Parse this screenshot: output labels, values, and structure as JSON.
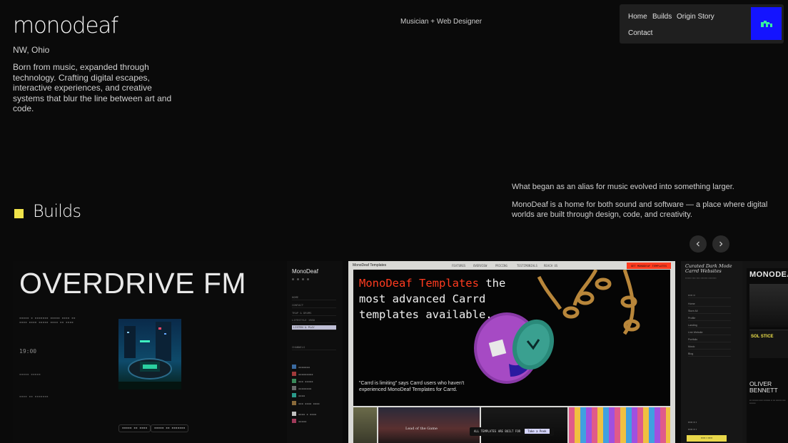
{
  "header": {
    "logo": "monodeaf",
    "location": "NW, Ohio",
    "bio": "Born from music, expanded through technology. Crafting digital escapes, interactive experiences, and creative systems that blur the line between art and code.",
    "tagline": "Musician + Web Designer"
  },
  "nav": {
    "items": [
      "Home",
      "Builds",
      "Origin Story",
      "Contact"
    ],
    "brand_mark_color": "#1414ff"
  },
  "about": {
    "line1": "What began as an alias for music evolved into something larger.",
    "line2": "MonoDeaf is a home for both sound and software — a place where digital worlds are built through design, code, and creativity."
  },
  "builds": {
    "heading": "Builds",
    "accent_color": "#f0e34a",
    "prev_icon": "chevron-left-icon",
    "next_icon": "chevron-right-icon"
  },
  "cards": {
    "overdrive": {
      "title": "OVERDRIVE FM",
      "time": "19:00",
      "sidebar_title": "MonoDeaf",
      "sidebar_items": [
        "HOME",
        "CONTACT",
        "TRAP & DRUMS",
        "LIFESTYLE 1980",
        "LISTEN & PLAY"
      ],
      "sidebar_subitem": "CHANNELS"
    },
    "templates": {
      "brand": "MonoDeaf Templates",
      "nav_links": [
        "FEATURES",
        "OVERVIEW",
        "PRICING",
        "TESTIMONIALS",
        "REACH US"
      ],
      "cta": "GET MONODEAF TEMPLATES",
      "headline_accent": "MonoDeaf Templates",
      "headline_rest": " the most advanced Carrd templates available.",
      "quote": "\"Carrd is limiting\" says Carrd users who haven't experienced MonoDeaf Templates for Carrd.",
      "thumb_caption": "Lead of the Game",
      "thumb_bar": "ALL TEMPLATES ARE BUILT FOR",
      "thumb_bar_btn": "Take a Peek"
    },
    "curated": {
      "title": "Curated Dark Mode Carrd Websites",
      "items": [
        "Home",
        "Store All",
        "Profile",
        "Landing",
        "Link Website",
        "Portfolio",
        "Music",
        "Blog"
      ],
      "right_title": "MONODEAF",
      "solstice": "SOL STICE",
      "oliver": "OLIVER BENNETT"
    }
  }
}
